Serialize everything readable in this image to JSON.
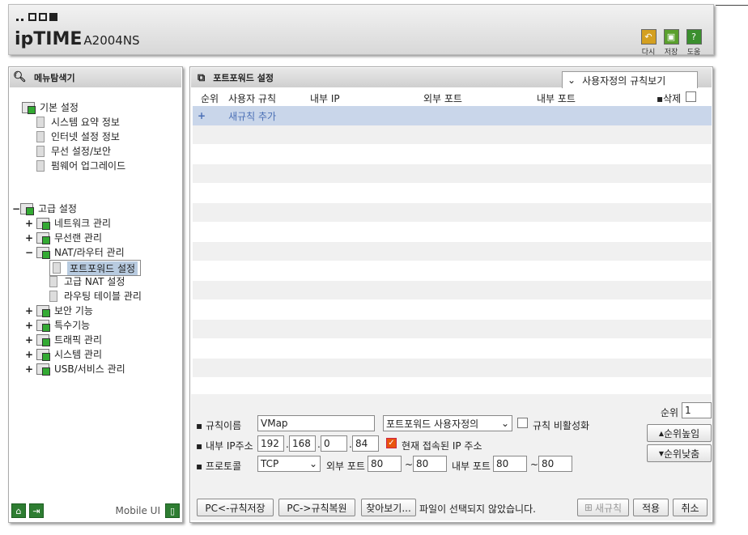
{
  "header": {
    "logo_text": "ipTIME",
    "model": "A2004NS",
    "buttons": [
      {
        "label": "다시",
        "icon": "undo-icon",
        "color": "#d4a020"
      },
      {
        "label": "저장",
        "icon": "save-icon",
        "color": "#5aa02c"
      },
      {
        "label": "도움",
        "icon": "help-icon",
        "color": "#3b8f2e"
      }
    ]
  },
  "sidebar": {
    "title": "메뉴탐색기",
    "basic": {
      "label": "기본 설정",
      "items": [
        "시스템 요약 정보",
        "인터넷 설정 정보",
        "무선 설정/보안",
        "펌웨어 업그레이드"
      ]
    },
    "advanced": {
      "toggle": "−",
      "label": "고급 설정",
      "items": [
        {
          "toggle": "+",
          "label": "네트워크 관리"
        },
        {
          "toggle": "+",
          "label": "무선랜 관리"
        },
        {
          "toggle": "−",
          "label": "NAT/라우터 관리"
        },
        {
          "toggle": "+",
          "label": "보안 기능"
        },
        {
          "toggle": "+",
          "label": "특수기능"
        },
        {
          "toggle": "+",
          "label": "트래픽 관리"
        },
        {
          "toggle": "+",
          "label": "시스템 관리"
        },
        {
          "toggle": "+",
          "label": "USB/서비스 관리"
        }
      ],
      "nat_children": [
        "포트포워드 설정",
        "고급 NAT 설정",
        "라우팅 테이블 관리"
      ],
      "selected": "포트포워드 설정"
    },
    "footer": {
      "mobile_label": "Mobile UI"
    }
  },
  "main": {
    "title": "포트포워드 설정",
    "view_button": "사용자정의 규칙보기",
    "columns": [
      "순위",
      "사용자 규칙",
      "내부 IP",
      "외부 포트",
      "내부 포트",
      "삭제"
    ],
    "new_rule_plus": "+",
    "new_rule_label": "새규칙 추가",
    "form": {
      "rule_name_label": "규칙이름",
      "rule_name_value": "VMap",
      "type_select": "포트포워드 사용자정의",
      "disable_label": "규칙 비활성화",
      "internal_ip_label": "내부 IP주소",
      "ip": [
        "192",
        "168",
        "0",
        "84"
      ],
      "ip_sep": ".",
      "current_ip_label": "현재 접속된 IP 주소",
      "current_ip_checked": true,
      "protocol_label": "프로토콜",
      "protocol_value": "TCP",
      "ext_port_label": "외부 포트",
      "ext_port_from": "80",
      "ext_port_to": "80",
      "int_port_label": "내부 포트",
      "int_port_from": "80",
      "int_port_to": "80",
      "range_sep": "~",
      "rank_label": "순위",
      "rank_value": "1",
      "rank_up": "순위높임",
      "rank_down": "순위낮춤"
    },
    "bottom": {
      "save_rules": "PC<-규칙저장",
      "restore_rules": "PC->규칙복원",
      "browse": "찾아보기...",
      "file_status": "파일이 선택되지 않았습니다.",
      "new_rule": "새규칙",
      "apply": "적용",
      "cancel": "취소"
    }
  }
}
